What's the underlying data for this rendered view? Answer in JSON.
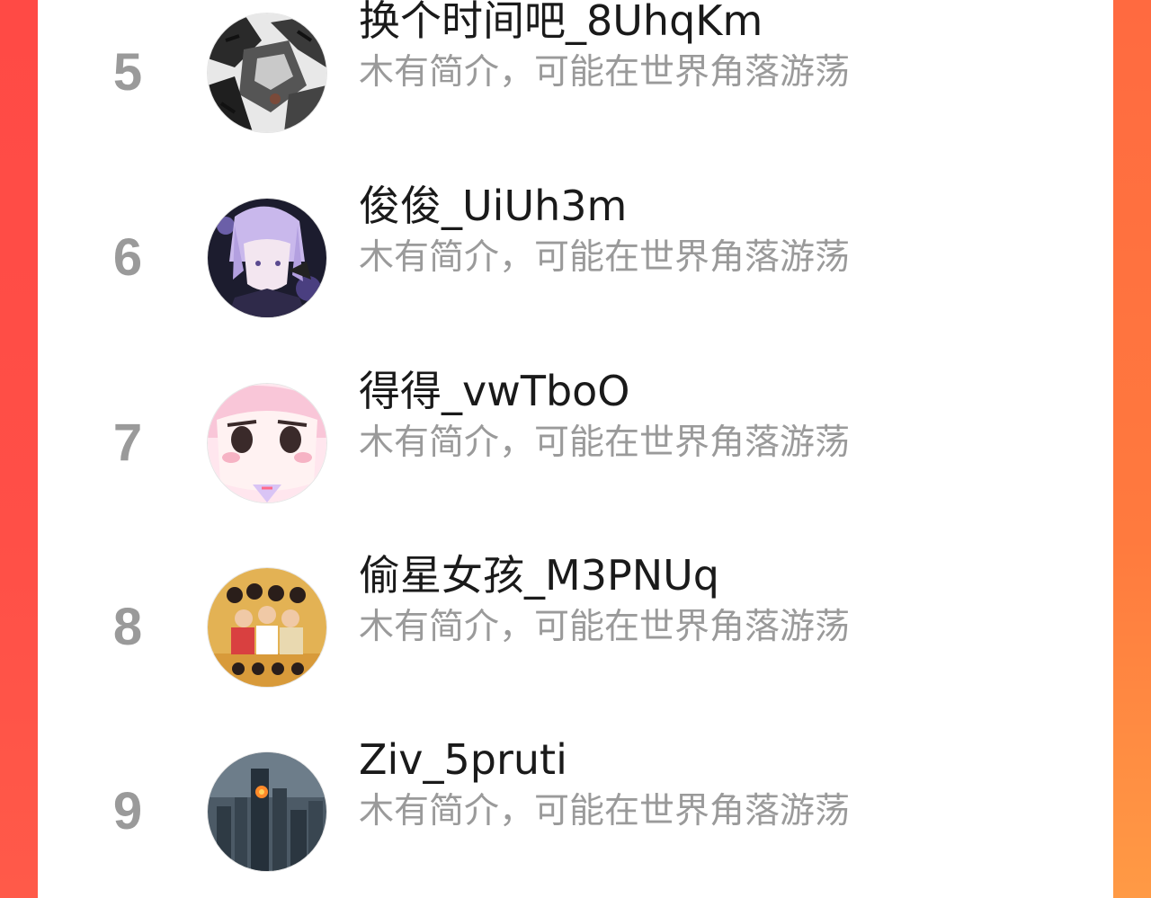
{
  "colors": {
    "edge_left": "#ff4a45",
    "edge_right": "#ff7a3e",
    "name_text": "#1a1a1a",
    "muted_text": "#9a9a9a",
    "panel_bg": "#ffffff"
  },
  "ranking": {
    "items": [
      {
        "rank": "5",
        "name": "换个时间吧_8UhqKm",
        "bio": "木有简介，可能在世界角落游荡",
        "avatar_icon": "anime-warrior-avatar"
      },
      {
        "rank": "6",
        "name": "俊俊_UiUh3m",
        "bio": "木有简介，可能在世界角落游荡",
        "avatar_icon": "anime-silver-hair-avatar"
      },
      {
        "rank": "7",
        "name": "得得_vwTboO",
        "bio": "木有简介，可能在世界角落游荡",
        "avatar_icon": "pink-cartoon-girl-avatar"
      },
      {
        "rank": "8",
        "name": "偷星女孩_M3PNUq",
        "bio": "木有简介，可能在世界角落游荡",
        "avatar_icon": "group-photo-avatar"
      },
      {
        "rank": "9",
        "name": "Ziv_5pruti",
        "bio": "木有简介，可能在世界角落游荡",
        "avatar_icon": "city-skyline-avatar"
      }
    ]
  }
}
